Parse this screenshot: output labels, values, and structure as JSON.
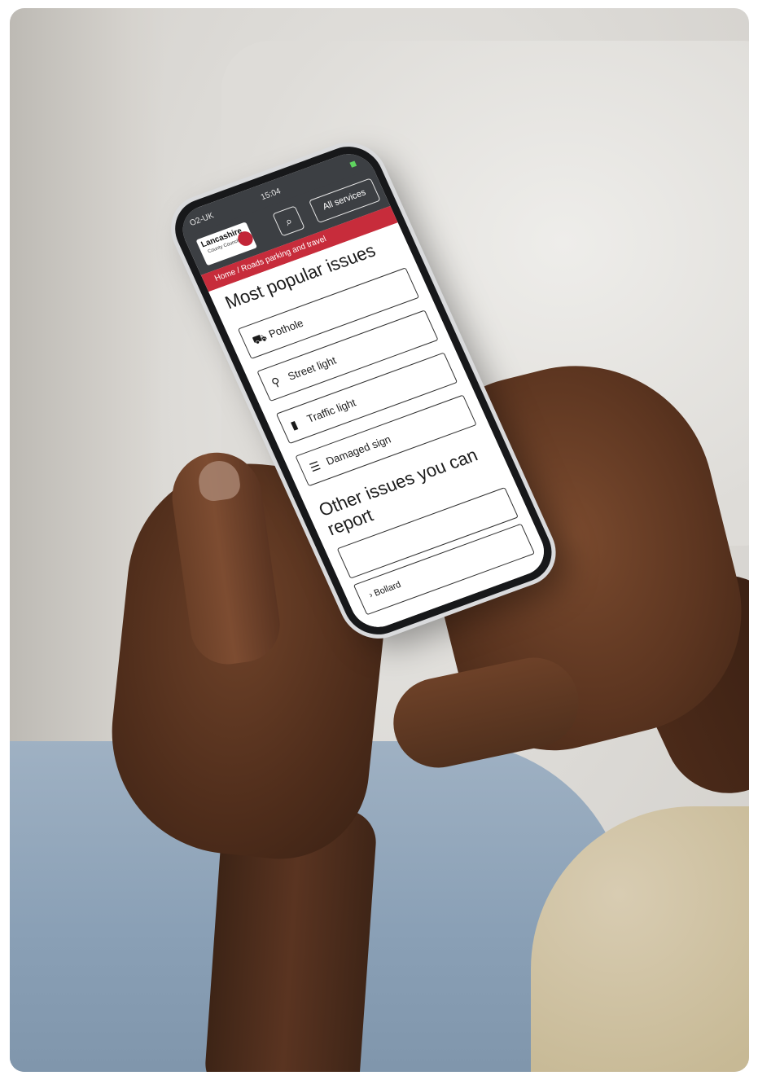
{
  "status_bar": {
    "carrier": "O2-UK",
    "time": "15:04",
    "battery": "◼"
  },
  "header": {
    "logo_name": "Lancashire",
    "logo_sub": "County Council",
    "search_icon": "search-icon",
    "all_services_label": "All services"
  },
  "breadcrumb": {
    "text": "Home / Roads parking and travel"
  },
  "main": {
    "popular_heading": "Most popular issues",
    "popular_issues": [
      {
        "label": "Pothole",
        "icon": "road-icon",
        "glyph": "⛟"
      },
      {
        "label": "Street light",
        "icon": "lightbulb-icon",
        "glyph": "💡"
      },
      {
        "label": "Traffic light",
        "icon": "traffic-light-icon",
        "glyph": "🚦"
      },
      {
        "label": "Damaged sign",
        "icon": "sign-icon",
        "glyph": "⚠"
      }
    ],
    "other_heading": "Other issues you can report",
    "other_issues": [
      {
        "label": ""
      },
      {
        "label": "› Bollard"
      }
    ]
  },
  "colors": {
    "header_bg": "#3c3f43",
    "accent_red": "#c72c3b"
  }
}
